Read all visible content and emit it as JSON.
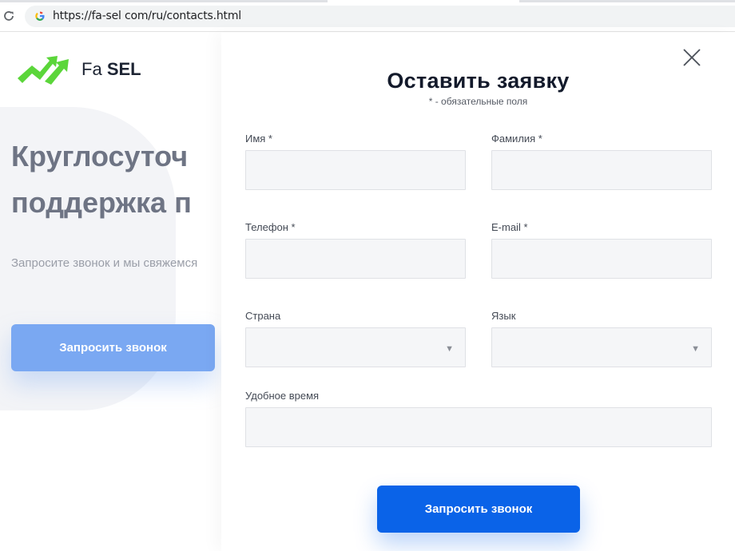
{
  "browser": {
    "url": "https://fa-sel com/ru/contacts.html"
  },
  "background": {
    "logo_light": "Fa",
    "logo_bold": "SEL",
    "hero_line1": "Круглосуточ",
    "hero_line2": "поддержка п",
    "hero_subtitle": "Запросите звонок и мы свяжемся",
    "hero_button": "Запросить звонок"
  },
  "modal": {
    "title": "Оставить заявку",
    "note": "* - обязательные поля",
    "fields": {
      "first_name": {
        "label": "Имя *",
        "value": ""
      },
      "last_name": {
        "label": "Фамилия *",
        "value": ""
      },
      "phone": {
        "label": "Телефон *",
        "value": ""
      },
      "email": {
        "label": "E-mail *",
        "value": ""
      },
      "country": {
        "label": "Страна",
        "value": ""
      },
      "language": {
        "label": "Язык",
        "value": ""
      },
      "time": {
        "label": "Удобное время",
        "value": ""
      }
    },
    "submit_label": "Запросить звонок"
  },
  "icons": {
    "reload": "reload-icon",
    "google": "google-icon",
    "logo": "logo-arrows-icon",
    "close": "close-icon",
    "dropdown": "dropdown-arrow-icon"
  },
  "colors": {
    "logo_green": "#5bd63a",
    "submit_blue": "#0a63e8",
    "hero_button_blue": "#7aa8f2"
  }
}
